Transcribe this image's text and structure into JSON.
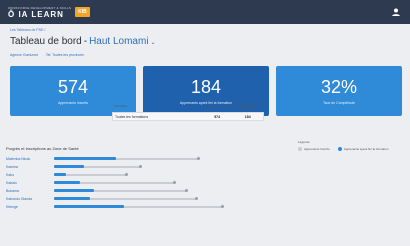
{
  "header": {
    "logo_tagline": "WORKFORCE DEVELOPMENT & SKILLS",
    "logo_text": "Ô IA LEARN",
    "logo_badge": "KIB"
  },
  "breadcrumb": "Les Tableaux de PSE /",
  "page": {
    "title": "Tableau de bord",
    "separator": "-",
    "selected_region": "Haut Lomami",
    "chevron": "⌄"
  },
  "filters": [
    {
      "label": "Agence Gomizont"
    },
    {
      "label": "Tel: Toutes les provinces"
    }
  ],
  "kpis": [
    {
      "value": "574",
      "label": "Apprenants Inscrits"
    },
    {
      "value": "184",
      "label": "Apprenants ayant fini la formation"
    },
    {
      "value": "32%",
      "label": "Taux de Complétude"
    }
  ],
  "mini_table": {
    "headers": [
      "Formation",
      "Apprenants Inscrits",
      "Apprenants ayant fini la formation"
    ],
    "row": [
      "Toutes les formations",
      "574",
      "184"
    ]
  },
  "progress_section": {
    "title": "Progrès et Inscriptions au Zone de Santé",
    "legend_title": "Légende",
    "legend": [
      {
        "label": "Apprenants Inscrits",
        "color": "#c9ccd2"
      },
      {
        "label": "Apprenants ayant fini la formation",
        "color": "#2f8ad8"
      }
    ],
    "max": 200,
    "rows": [
      {
        "label": "Malemba Nkulu",
        "enrolled": 120,
        "completed": 52
      },
      {
        "label": "Kamina",
        "enrolled": 72,
        "completed": 25
      },
      {
        "label": "Kabo",
        "enrolled": 60,
        "completed": 10
      },
      {
        "label": "Kabalo",
        "enrolled": 100,
        "completed": 22
      },
      {
        "label": "Bukama",
        "enrolled": 110,
        "completed": 33
      },
      {
        "label": "Kabondo Dianda",
        "enrolled": 118,
        "completed": 30
      },
      {
        "label": "Kitenge",
        "enrolled": 140,
        "completed": 58
      }
    ]
  }
}
